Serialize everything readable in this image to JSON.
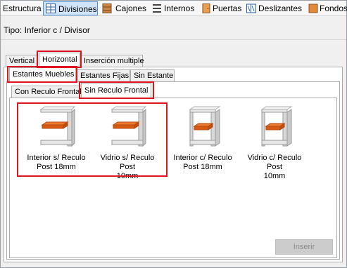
{
  "toolbar": {
    "items": [
      {
        "label": "Estructura",
        "icon": null
      },
      {
        "label": "Divisiones",
        "icon": "divisions-grid-icon"
      },
      {
        "label": "Cajones",
        "icon": "drawers-icon"
      },
      {
        "label": "Internos",
        "icon": "internals-icon"
      },
      {
        "label": "Puertas",
        "icon": "door-icon"
      },
      {
        "label": "Deslizantes",
        "icon": "sliding-door-icon"
      },
      {
        "label": "Fondos",
        "icon": "back-panel-icon"
      }
    ],
    "active": "Divisiones"
  },
  "path_text": "Tipo: Inferior c / Divisor",
  "tabs_level1": [
    "Vertical",
    "Horizontal",
    "Inserción multiple"
  ],
  "tabs_level2": [
    "Estantes Muebles",
    "Estantes Fijas",
    "Sin Estante"
  ],
  "tabs_level3": [
    "Con Reculo Frontal",
    "Sin Reculo Frontal"
  ],
  "selected": {
    "level1": "Horizontal",
    "level2": "Estantes Muebles",
    "level3": "Sin Reculo Frontal"
  },
  "items": [
    {
      "caption": "Interior s/ Reculo\nPost 18mm",
      "icon": "shelf-orange-icon",
      "highlighted": true
    },
    {
      "caption": "Vidrio s/ Reculo Post\n10mm",
      "icon": "shelf-orange-icon",
      "highlighted": true
    },
    {
      "caption": "Interior c/ Reculo\nPost 18mm",
      "icon": "shelf-orange-icon",
      "highlighted": false
    },
    {
      "caption": "Vidrio c/ Reculo Post\n10mm",
      "icon": "shelf-orange-icon",
      "highlighted": false
    }
  ],
  "insert_button": {
    "label": "Inserir",
    "enabled": false
  },
  "colors": {
    "highlight": "#e0141e",
    "shelf": "#e2661c",
    "active_toolbar": "#cfe4f8"
  }
}
